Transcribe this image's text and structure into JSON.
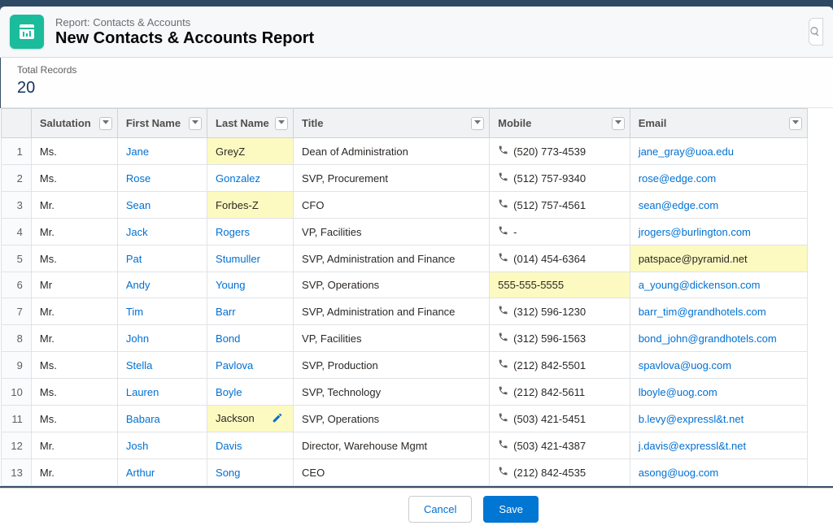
{
  "header": {
    "kicker": "Report: Contacts & Accounts",
    "title": "New Contacts & Accounts Report"
  },
  "summary": {
    "label": "Total Records",
    "value": "20"
  },
  "columns": {
    "salutation": "Salutation",
    "first_name": "First Name",
    "last_name": "Last Name",
    "title": "Title",
    "mobile": "Mobile",
    "email": "Email"
  },
  "rows": [
    {
      "n": "1",
      "sal": "Ms.",
      "first": "Jane",
      "last": "GreyZ",
      "last_hl": true,
      "title": "Dean of Administration",
      "mobile": "(520) 773-4539",
      "mobile_hl": false,
      "email": "jane_gray@uoa.edu",
      "email_hl": false
    },
    {
      "n": "2",
      "sal": "Ms.",
      "first": "Rose",
      "last": "Gonzalez",
      "last_hl": false,
      "title": "SVP, Procurement",
      "mobile": "(512) 757-9340",
      "mobile_hl": false,
      "email": "rose@edge.com",
      "email_hl": false
    },
    {
      "n": "3",
      "sal": "Mr.",
      "first": "Sean",
      "last": "Forbes-Z",
      "last_hl": true,
      "title": "CFO",
      "mobile": "(512) 757-4561",
      "mobile_hl": false,
      "email": "sean@edge.com",
      "email_hl": false
    },
    {
      "n": "4",
      "sal": "Mr.",
      "first": "Jack",
      "last": "Rogers",
      "last_hl": false,
      "title": "VP, Facilities",
      "mobile": "-",
      "mobile_hl": false,
      "email": "jrogers@burlington.com",
      "email_hl": false
    },
    {
      "n": "5",
      "sal": "Ms.",
      "first": "Pat",
      "last": "Stumuller",
      "last_hl": false,
      "title": "SVP, Administration and Finance",
      "mobile": "(014) 454-6364",
      "mobile_hl": false,
      "email": "patspace@pyramid.net",
      "email_hl": true
    },
    {
      "n": "6",
      "sal": "Mr",
      "first": "Andy",
      "last": "Young",
      "last_hl": false,
      "title": "SVP, Operations",
      "mobile": "555-555-5555",
      "mobile_hl": true,
      "email": "a_young@dickenson.com",
      "email_hl": false,
      "mobile_raw": true
    },
    {
      "n": "7",
      "sal": "Mr.",
      "first": "Tim",
      "last": "Barr",
      "last_hl": false,
      "title": "SVP, Administration and Finance",
      "mobile": "(312) 596-1230",
      "mobile_hl": false,
      "email": "barr_tim@grandhotels.com",
      "email_hl": false
    },
    {
      "n": "8",
      "sal": "Mr.",
      "first": "John",
      "last": "Bond",
      "last_hl": false,
      "title": "VP, Facilities",
      "mobile": "(312) 596-1563",
      "mobile_hl": false,
      "email": "bond_john@grandhotels.com",
      "email_hl": false
    },
    {
      "n": "9",
      "sal": "Ms.",
      "first": "Stella",
      "last": "Pavlova",
      "last_hl": false,
      "title": "SVP, Production",
      "mobile": "(212) 842-5501",
      "mobile_hl": false,
      "email": "spavlova@uog.com",
      "email_hl": false
    },
    {
      "n": "10",
      "sal": "Ms.",
      "first": "Lauren",
      "last": "Boyle",
      "last_hl": false,
      "title": "SVP, Technology",
      "mobile": "(212) 842-5611",
      "mobile_hl": false,
      "email": "lboyle@uog.com",
      "email_hl": false
    },
    {
      "n": "11",
      "sal": "Ms.",
      "first": "Babara",
      "last": "Jackson",
      "last_hl": true,
      "title": "SVP, Operations",
      "mobile": "(503) 421-5451",
      "mobile_hl": false,
      "email": "b.levy@expressl&t.net",
      "email_hl": false,
      "editing": true
    },
    {
      "n": "12",
      "sal": "Mr.",
      "first": "Josh",
      "last": "Davis",
      "last_hl": false,
      "title": "Director, Warehouse Mgmt",
      "mobile": "(503) 421-4387",
      "mobile_hl": false,
      "email": "j.davis@expressl&t.net",
      "email_hl": false
    },
    {
      "n": "13",
      "sal": "Mr.",
      "first": "Arthur",
      "last": "Song",
      "last_hl": false,
      "title": "CEO",
      "mobile": "(212) 842-4535",
      "mobile_hl": false,
      "email": "asong@uog.com",
      "email_hl": false
    }
  ],
  "footer": {
    "cancel": "Cancel",
    "save": "Save"
  }
}
